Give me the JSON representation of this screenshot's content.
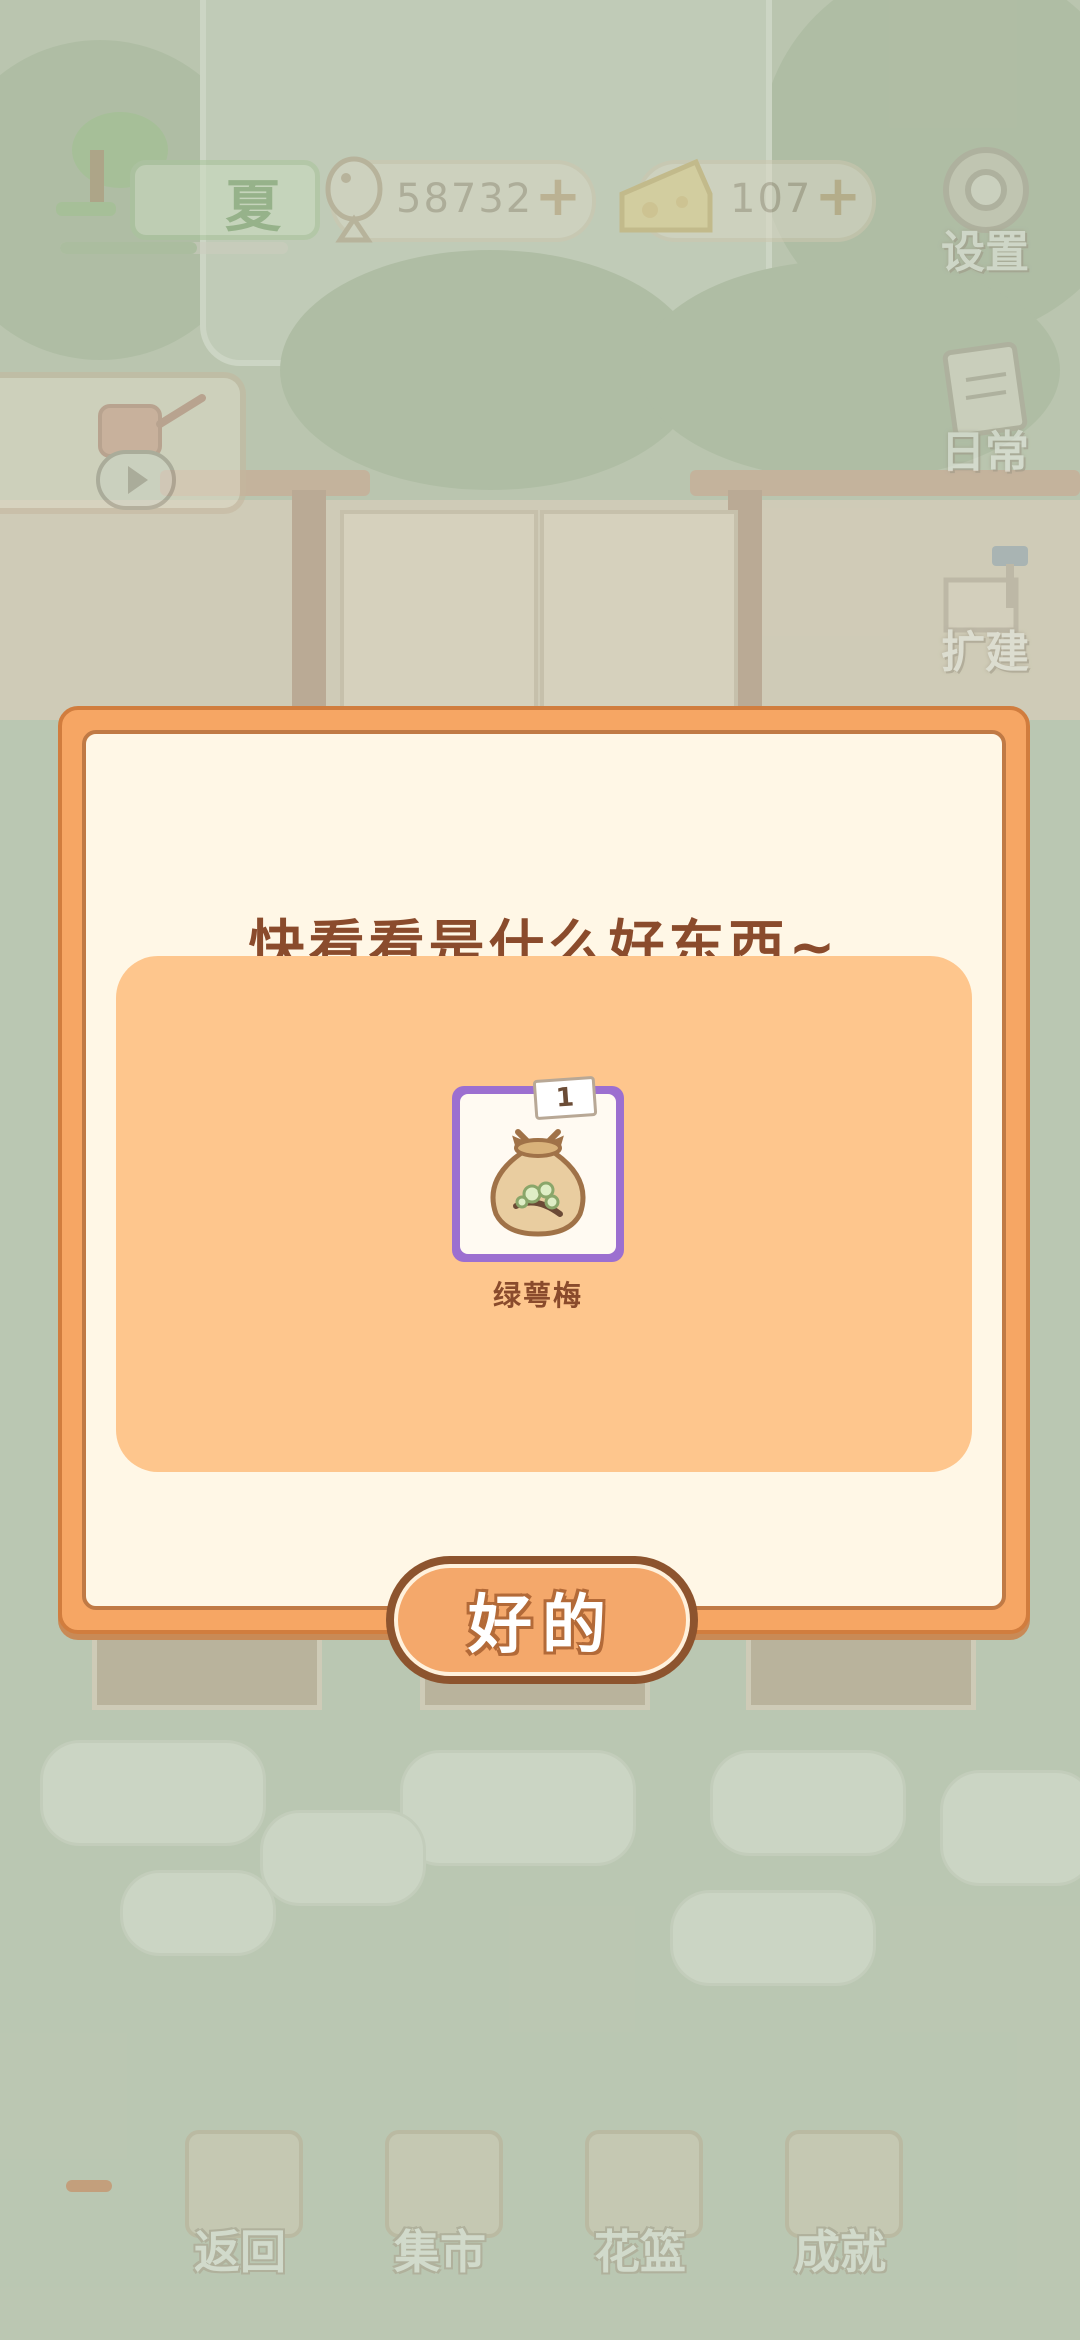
{
  "hud": {
    "season_label": "夏",
    "season_progress": 0.6,
    "fish_coins": "58732",
    "cheese": "107"
  },
  "side_buttons": {
    "settings": "设置",
    "daily": "日常",
    "expand": "扩建"
  },
  "dialog": {
    "title": "快看看是什么好东西~",
    "item": {
      "name": "绿萼梅",
      "quantity": "1",
      "icon": "seed-bag-icon",
      "rarity_color": "#9c6fd0"
    },
    "ok_label": "好的"
  },
  "bottom_nav": {
    "back": "返回",
    "market": "集市",
    "basket": "花篮",
    "achievements": "成就"
  },
  "colors": {
    "dialog_border": "#f6a664",
    "reward_bg": "#fec68d",
    "title_text": "#8a4b2c"
  }
}
